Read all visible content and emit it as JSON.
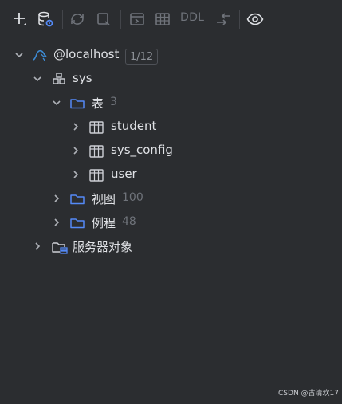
{
  "toolbar": {
    "ddl_label": "DDL"
  },
  "tree": {
    "connection": {
      "label": "@localhost",
      "badge": "1/12"
    },
    "schema": {
      "label": "sys"
    },
    "tables_folder": {
      "label": "表",
      "count": "3"
    },
    "tables": [
      {
        "label": "student"
      },
      {
        "label": "sys_config"
      },
      {
        "label": "user"
      }
    ],
    "views_folder": {
      "label": "视图",
      "count": "100"
    },
    "routines_folder": {
      "label": "例程",
      "count": "48"
    },
    "server_objects": {
      "label": "服务器对象"
    }
  },
  "watermark": "CSDN @古清欢17",
  "colors": {
    "background": "#2b2d30",
    "folder": "#548af7",
    "mysql_logo": "#3d8bd4",
    "muted": "#6f737a"
  }
}
